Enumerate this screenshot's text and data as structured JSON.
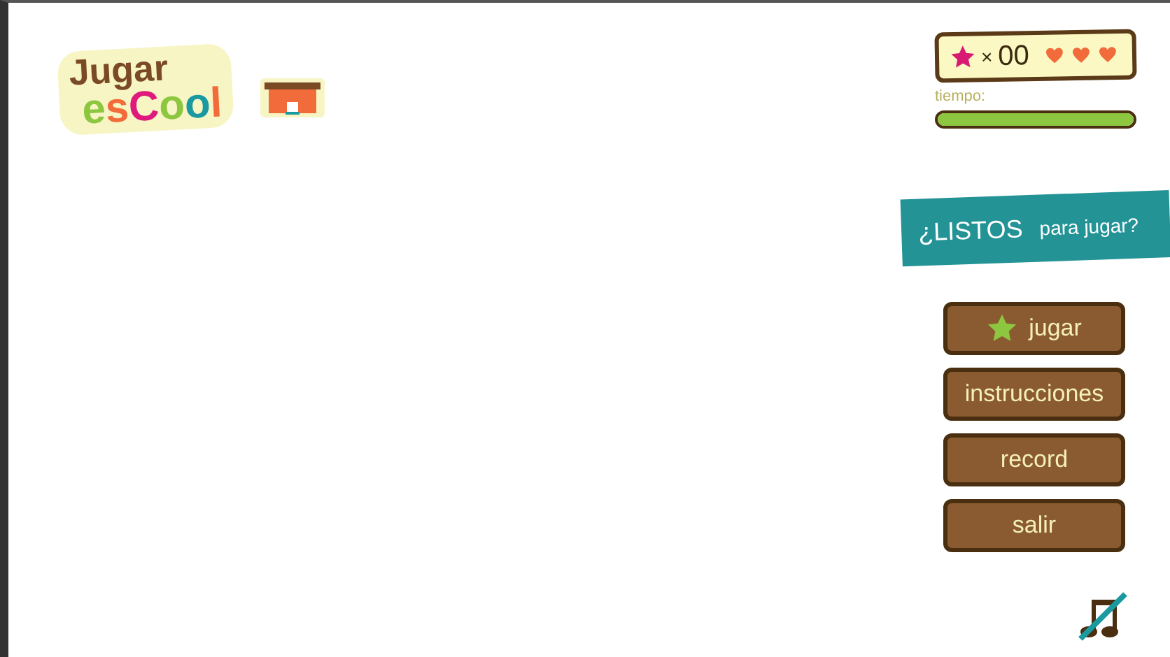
{
  "logo": {
    "line1": "Jugar",
    "line2": [
      {
        "text": "e",
        "color": "#8dc63f"
      },
      {
        "text": "s",
        "color": "#f26b3a"
      },
      {
        "text": "C",
        "color": "#e0197d"
      },
      {
        "text": "o",
        "color": "#8dc63f"
      },
      {
        "text": "o",
        "color": "#1a9aa0"
      },
      {
        "text": "l",
        "color": "#f26b3a"
      }
    ]
  },
  "score": {
    "times": "×",
    "count": "00"
  },
  "timer": {
    "label": "tiempo:",
    "level": 1
  },
  "banner": {
    "lead": "¿LISTOS",
    "rest": "para jugar?"
  },
  "menu": [
    {
      "label": "jugar",
      "kind": "star"
    },
    {
      "label": "instrucciones",
      "kind": "plain"
    },
    {
      "label": "record",
      "kind": "plain"
    },
    {
      "label": "salir",
      "kind": "plain"
    }
  ],
  "music": {
    "muted": true
  }
}
